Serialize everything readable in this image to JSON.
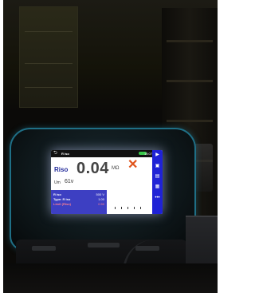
{
  "photo": {
    "subject": "handheld installation tester photographed in a dark room",
    "accent_colors": {
      "rim": "#1f6f86",
      "sidebar": "#1f22d6",
      "cross": "#e0541c",
      "battery": "#39c84a"
    }
  },
  "screen": {
    "header": {
      "back_icon": "back-arrow-icon",
      "title": "R iso",
      "time": "15:07"
    },
    "measurement": {
      "label": "Riso",
      "value": "0.04",
      "unit": "MΩ",
      "status_icon": "cross-icon"
    },
    "secondary": {
      "label": "Um",
      "value": "61v"
    },
    "parameters": [
      {
        "name": "R iso",
        "value": "500 V"
      },
      {
        "name": "Type: R iso",
        "value": "1.00"
      },
      {
        "name": "Limit (Riso)",
        "value": "0.50"
      }
    ],
    "sidebar_icons": [
      "play-icon",
      "save-icon",
      "document-icon",
      "settings-icon",
      "more-icon"
    ]
  }
}
